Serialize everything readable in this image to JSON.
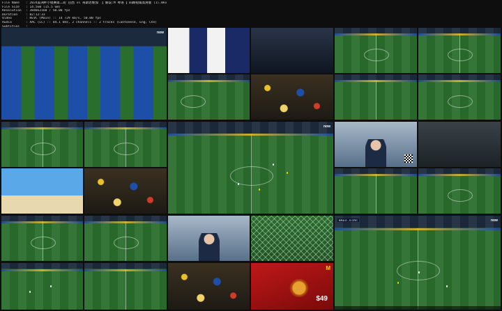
{
  "file_info": [
    {
      "key": "File Name",
      "value": ": 2024美洲杯小组赛第二轮 巴西 vs 哥斯达黎加 【 解说:M 粤语 】四路视角高清版 (1).mkv"
    },
    {
      "key": "File Size",
      "value": ": 14.5GB (15.5 GB)"
    },
    {
      "key": "Resolution",
      "value": ": 3840x2160 / 50.00 fps"
    },
    {
      "key": "Duration",
      "value": ": 02:12:33"
    },
    {
      "key": "Video",
      "value": ": HEVC (Main) :: 14 729 kb/s, 50.00 fps"
    },
    {
      "key": "Audio",
      "value": ": AAC (LC) :: 44.1 kHz, 2 channels :: 2 tracks (Cantonese, Eng, Chn)"
    },
    {
      "key": "Subtitles",
      "value": ":"
    }
  ],
  "thumbnails": [
    {
      "id": "t1",
      "kind": "team",
      "logo": "now"
    },
    {
      "id": "t2",
      "kind": "kits"
    },
    {
      "id": "t3",
      "kind": "tunnel"
    },
    {
      "id": "t4",
      "kind": "pitch"
    },
    {
      "id": "t5",
      "kind": "pitch"
    },
    {
      "id": "t6",
      "kind": "pitch"
    },
    {
      "id": "t7",
      "kind": "pitch"
    },
    {
      "id": "t8",
      "kind": "pitch"
    },
    {
      "id": "t9",
      "kind": "pitch"
    },
    {
      "id": "t10",
      "kind": "pitch"
    },
    {
      "id": "t11",
      "kind": "pitch"
    },
    {
      "id": "t12",
      "kind": "pitch",
      "logo": "now"
    },
    {
      "id": "t13",
      "kind": "studio"
    },
    {
      "id": "t14",
      "kind": "night"
    },
    {
      "id": "t15",
      "kind": "sky"
    },
    {
      "id": "t16",
      "kind": "crowd"
    },
    {
      "id": "t17",
      "kind": "pitch"
    },
    {
      "id": "t18",
      "kind": "pitch"
    },
    {
      "id": "t19",
      "kind": "pitch"
    },
    {
      "id": "t20",
      "kind": "pitch"
    },
    {
      "id": "t21",
      "kind": "studio"
    },
    {
      "id": "t22",
      "kind": "net"
    },
    {
      "id": "t23",
      "kind": "pitch",
      "scorebug": "BRA 0 - 0 CRC",
      "logo": "now"
    },
    {
      "id": "t24",
      "kind": "pitch"
    },
    {
      "id": "t25",
      "kind": "pitch"
    },
    {
      "id": "t26",
      "kind": "ad",
      "price": "$49"
    },
    {
      "id": "t27",
      "kind": "crowd"
    }
  ]
}
